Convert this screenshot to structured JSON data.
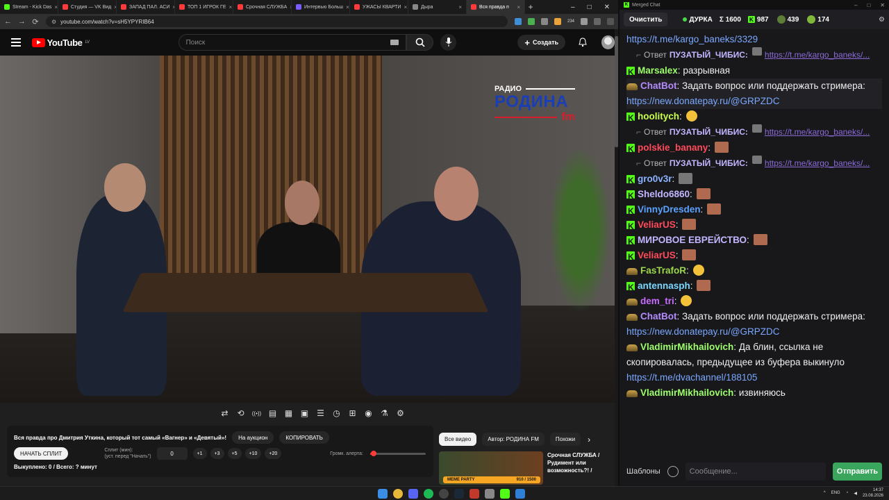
{
  "browser": {
    "tabs": [
      {
        "label": "Stream - Kick Das",
        "color": "#53fc18"
      },
      {
        "label": "Студия — VK Вид",
        "color": "#ff3b3b"
      },
      {
        "label": "ЗАПАД ПАЛ. АСИ",
        "color": "#ff3b3b"
      },
      {
        "label": "ТОП 1 ИГРОК ГЕ",
        "color": "#ff3b3b"
      },
      {
        "label": "Срочная СЛУЖБА",
        "color": "#ff3b3b"
      },
      {
        "label": "Интервью Больш",
        "color": "#7a5cff"
      },
      {
        "label": "УЖАСЫ КВАРТИ",
        "color": "#ff3b3b"
      },
      {
        "label": "Дыра",
        "color": "#888888"
      },
      {
        "label": "Вся правда п",
        "color": "#ff3b3b"
      }
    ],
    "url": "youtube.com/watch?v=sH5YPYRIB64",
    "ext_badge": "234"
  },
  "youtube": {
    "logo_text": "YouTube",
    "country": "LV",
    "search_placeholder": "Поиск",
    "create_label": "Создать"
  },
  "video": {
    "watermark_top": "РАДИО",
    "watermark_main": "РОДИНА",
    "watermark_fm": "fm"
  },
  "toolbar_icons": [
    "loop-icon",
    "repeat-icon",
    "broadcast-icon",
    "playlist-add-icon",
    "clapper-icon",
    "picture-in-picture-icon",
    "subtitles-icon",
    "speed-icon",
    "screenshot-add-icon",
    "camera-icon",
    "flask-icon",
    "gear-icon"
  ],
  "panel": {
    "video_title": "Вся правда про Дмитрия Уткина, который тот самый «Вагнер» и «Девятый»!",
    "auction_label": "На аукцион",
    "copy_label": "КОПИРОВАТЬ",
    "start_split_label": "НАЧАТЬ СПЛИТ",
    "split_label": "Сплит (мин):",
    "split_hint": "(уст. перед \"Начать\")",
    "split_value": "0",
    "increments": [
      "+1",
      "+3",
      "+5",
      "+10",
      "+20"
    ],
    "volume_label": "Громк. алерта:",
    "volume_level": 0.06,
    "bought_text": "Выкуплено: 0 / Всего: ? минут"
  },
  "related": {
    "chips": [
      "Все видео",
      "Автор: РОДИНА FM",
      "Похожи"
    ],
    "video_title": "Срочная СЛУЖБА / Рудимент или возможность?! /",
    "thumb_tag": "MEME PARTY",
    "thumb_progress": "910 / 1500"
  },
  "chat": {
    "window_title": "Merged Chat",
    "clear_label": "Очистить",
    "channel": "ДУРКА",
    "total": "Σ 1600",
    "kick_count": "987",
    "twitch_count": "439",
    "other_count": "174",
    "templates_label": "Шаблоны",
    "message_placeholder": "Сообщение...",
    "send_label": "Отправить",
    "messages": [
      {
        "type": "link",
        "text": "https://t.me/kargo_baneks/3329"
      },
      {
        "type": "reply",
        "label": "Ответ",
        "user": "ПУЗАТЫЙ_ЧИБИС:",
        "link": "https://t.me/kargo_baneks/..."
      },
      {
        "type": "msg",
        "badge": "kick",
        "user": "Marsalex",
        "color": "#9dff6a",
        "text": "разрывная"
      },
      {
        "type": "msg",
        "badge": "twitch",
        "user": "ChatBot",
        "color": "#b58cff",
        "text": "Задать вопрос или поддержать стримера: ",
        "link": "https://new.donatepay.ru/@GRPZDC",
        "hl": true
      },
      {
        "type": "msg",
        "badge": "kick",
        "user": "hoolitych",
        "color": "#c8ff4a",
        "text": "",
        "emote": "e-yel"
      },
      {
        "type": "reply",
        "label": "Ответ",
        "user": "ПУЗАТЫЙ_ЧИБИС:",
        "link": "https://t.me/kargo_baneks/..."
      },
      {
        "type": "msg",
        "badge": "kick",
        "user": "polskie_banany",
        "color": "#ff4a5a",
        "text": "",
        "emote": "e-face"
      },
      {
        "type": "reply",
        "label": "Ответ",
        "user": "ПУЗАТЫЙ_ЧИБИС:",
        "link": "https://t.me/kargo_baneks/..."
      },
      {
        "type": "msg",
        "badge": "kick",
        "user": "gro0v3r",
        "color": "#8ab4ff",
        "text": "",
        "emote": "e-grey"
      },
      {
        "type": "msg",
        "badge": "kick",
        "user": "Sheldo6860",
        "color": "#c4b5ff",
        "text": "",
        "emote": "e-face"
      },
      {
        "type": "msg",
        "badge": "kick",
        "user": "VinnyDresden",
        "color": "#5aa2ff",
        "text": "",
        "emote": "e-face"
      },
      {
        "type": "msg",
        "badge": "kick",
        "user": "VeliarUS",
        "color": "#ff4a5a",
        "text": "",
        "emote": "e-face"
      },
      {
        "type": "msg",
        "badge": "kick",
        "user": "МИРОВОЕ ЕВРЕЙСТВО",
        "color": "#c4b5ff",
        "text": "",
        "emote": "e-face"
      },
      {
        "type": "msg",
        "badge": "kick",
        "user": "VeliarUS",
        "color": "#ff4a5a",
        "text": "",
        "emote": "e-face"
      },
      {
        "type": "msg",
        "badge": "twitch",
        "user": "FasTrafoR",
        "color": "#9dd84b",
        "text": "",
        "emote": "e-yel"
      },
      {
        "type": "msg",
        "badge": "kick",
        "user": "antennasph",
        "color": "#7ad8ff",
        "text": "",
        "emote": "e-face"
      },
      {
        "type": "msg",
        "badge": "twitch",
        "user": "dem_tri",
        "color": "#c86bff",
        "text": "",
        "emote": "e-yel"
      },
      {
        "type": "msg",
        "badge": "twitch",
        "user": "ChatBot",
        "color": "#b58cff",
        "text": "Задать вопрос или поддержать стримера: ",
        "link": "https://new.donatepay.ru/@GRPZDC"
      },
      {
        "type": "msg",
        "badge": "twitch",
        "user": "VladimirMikhailovich",
        "color": "#9dff6a",
        "text": "Да блин, ссылка не скопировалась, предыдущее из буфера выкинуло ",
        "link": "https://t.me/dvachannel/188105"
      },
      {
        "type": "msg",
        "badge": "twitch",
        "user": "VladimirMikhailovich",
        "color": "#9dff6a",
        "text": "извиняюсь"
      }
    ]
  },
  "taskbar": {
    "lang": "ENG",
    "time": "14:37",
    "date": "23.08.2026"
  },
  "colors": {
    "kick_green": "#53fc18",
    "youtube_red": "#ff0000",
    "send_green": "#3aa55c"
  }
}
